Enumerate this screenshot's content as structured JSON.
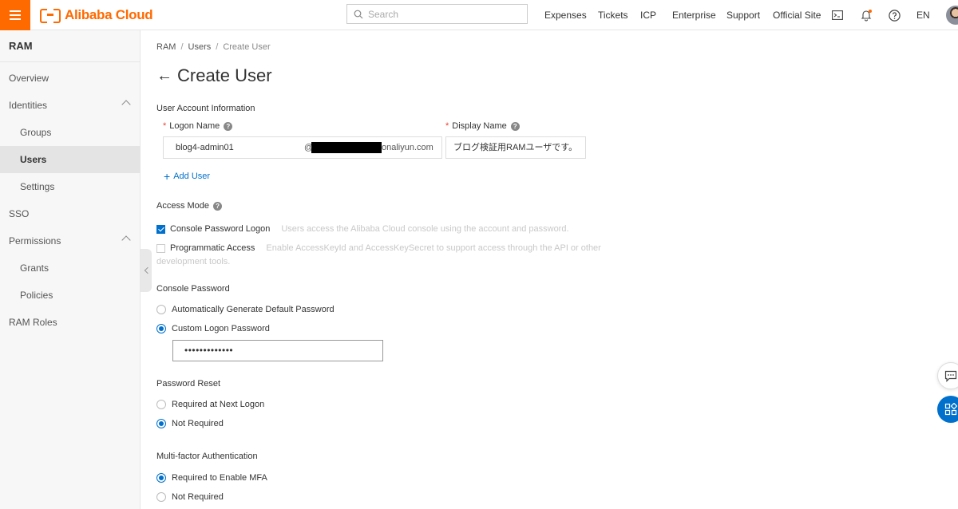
{
  "topbar": {
    "brand": "Alibaba Cloud",
    "search_placeholder": "Search",
    "nav": [
      "Expenses",
      "Tickets",
      "ICP",
      "Enterprise",
      "Support",
      "Official Site"
    ],
    "language": "EN",
    "accent_color": "#ff6a00"
  },
  "sidebar": {
    "title": "RAM",
    "items": [
      {
        "label": "Overview"
      },
      {
        "label": "Identities",
        "expanded": true
      },
      {
        "label": "Groups"
      },
      {
        "label": "Users",
        "active": true
      },
      {
        "label": "Settings"
      },
      {
        "label": "SSO"
      },
      {
        "label": "Permissions",
        "expanded": true
      },
      {
        "label": "Grants"
      },
      {
        "label": "Policies"
      },
      {
        "label": "RAM Roles"
      }
    ]
  },
  "breadcrumb": [
    "RAM",
    "Users",
    "Create User"
  ],
  "page_title": "Create User",
  "user_account": {
    "section_label": "User Account Information",
    "logon_name_label": "Logon Name",
    "display_name_label": "Display Name",
    "logon_name_value": "blog4-admin01",
    "logon_domain_prefix": "@",
    "logon_domain_suffix": "onaliyun.com",
    "display_name_value": "ブログ検証用RAMユーザです。",
    "add_user_label": "Add User"
  },
  "access_mode": {
    "label": "Access Mode",
    "console_label": "Console Password Logon",
    "console_checked": true,
    "console_hint": "Users access the Alibaba Cloud console using the account and password.",
    "programmatic_label": "Programmatic Access",
    "programmatic_checked": false,
    "programmatic_hint": "Enable AccessKeyId and AccessKeySecret to support access through the API or other",
    "programmatic_hint_2": "development tools."
  },
  "console_password": {
    "label": "Console Password",
    "option_auto": "Automatically Generate Default Password",
    "option_custom": "Custom Logon Password",
    "selected": "custom",
    "password_masked": "•••••••••••••"
  },
  "password_reset": {
    "label": "Password Reset",
    "option_required": "Required at Next Logon",
    "option_not_required": "Not Required",
    "selected": "not_required"
  },
  "mfa": {
    "label": "Multi-factor Authentication",
    "option_required": "Required to Enable MFA",
    "option_not_required": "Not Required",
    "selected": "required"
  },
  "colors": {
    "link": "#0070cc",
    "required": "#f04134"
  }
}
